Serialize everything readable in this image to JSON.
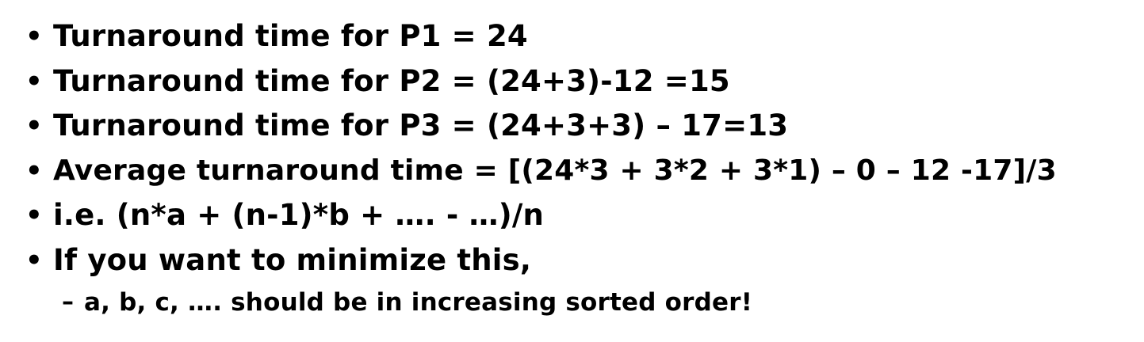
{
  "bullets": [
    {
      "marker": "•",
      "text": "Turnaround time for P1 = 24"
    },
    {
      "marker": "•",
      "text": "Turnaround time for P2 = (24+3)-12 =15"
    },
    {
      "marker": "•",
      "text": "Turnaround time for P3 = (24+3+3) – 17=13"
    },
    {
      "marker": "•",
      "text": "Average turnaround time = [(24*3 + 3*2 + 3*1) – 0 – 12 -17]/3"
    },
    {
      "marker": "•",
      "text": "i.e. (n*a + (n-1)*b + …. - …)/n"
    },
    {
      "marker": "•",
      "text": "If you want to minimize this,"
    }
  ],
  "sub_bullets": [
    {
      "marker": "–",
      "text": "a, b, c, …. should be in increasing sorted order!"
    }
  ]
}
